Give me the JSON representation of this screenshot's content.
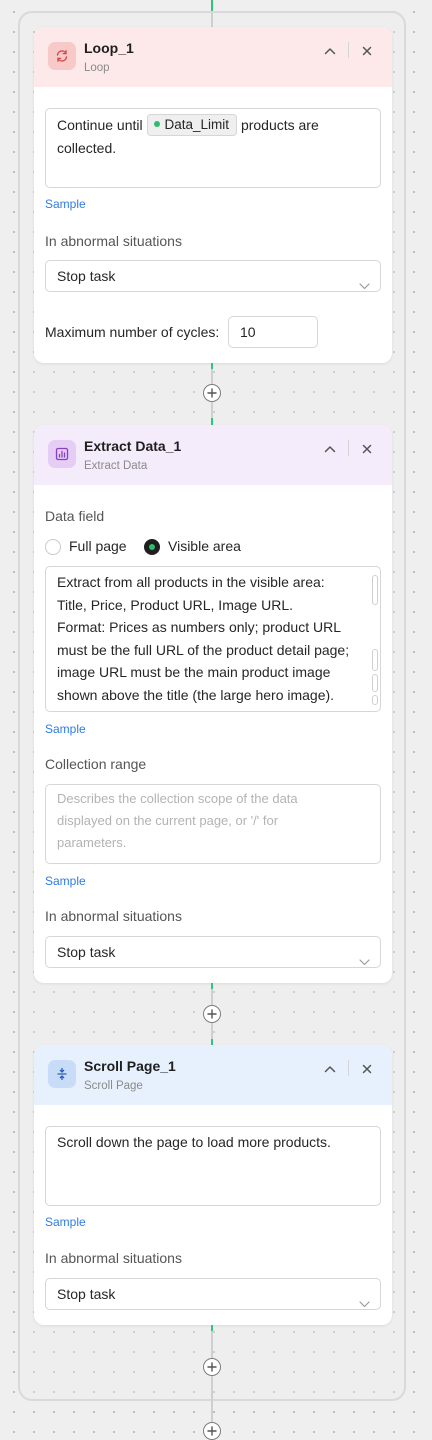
{
  "loop_node": {
    "title": "Loop_1",
    "subtitle": "Loop",
    "icon": "loop-icon",
    "condition_prefix": "Continue until",
    "condition_variable": "Data_Limit",
    "condition_suffix": "products are",
    "condition_line2": "collected.",
    "sample_label": "Sample",
    "abnormal_label": "In abnormal situations",
    "abnormal_value": "Stop task",
    "max_cycles_label": "Maximum number of cycles:",
    "max_cycles_value": "10"
  },
  "extract_node": {
    "title": "Extract Data_1",
    "subtitle": "Extract Data",
    "icon": "chart-icon",
    "data_field_label": "Data field",
    "option_full_page": "Full page",
    "option_visible_area": "Visible area",
    "selected_option": "Visible area",
    "instruction_lines": [
      "Extract from all products in the visible area:",
      "Title, Price, Product URL, Image URL.",
      "Format: Prices as numbers only; product URL",
      "must be the full URL of the product detail page;",
      "image URL must be the main product image",
      "shown above the title (the large hero image)."
    ],
    "sample_label": "Sample",
    "collection_range_label": "Collection range",
    "collection_range_placeholder_lines": [
      "Describes the collection scope of the data",
      "displayed on the current page, or '/' for",
      "parameters."
    ],
    "sample_label_2": "Sample",
    "abnormal_label": "In abnormal situations",
    "abnormal_value": "Stop task"
  },
  "scroll_node": {
    "title": "Scroll Page_1",
    "subtitle": "Scroll Page",
    "icon": "scroll-vertical-icon",
    "instruction": "Scroll down the page to load more products.",
    "sample_label": "Sample",
    "abnormal_label": "In abnormal situations",
    "abnormal_value": "Stop task"
  },
  "colors": {
    "connector_green": "#34c37c",
    "link_blue": "#2f7be5",
    "loop_header": "#fde9e9",
    "extract_header": "#f5ecfb",
    "scroll_header": "#e7f0fd"
  }
}
